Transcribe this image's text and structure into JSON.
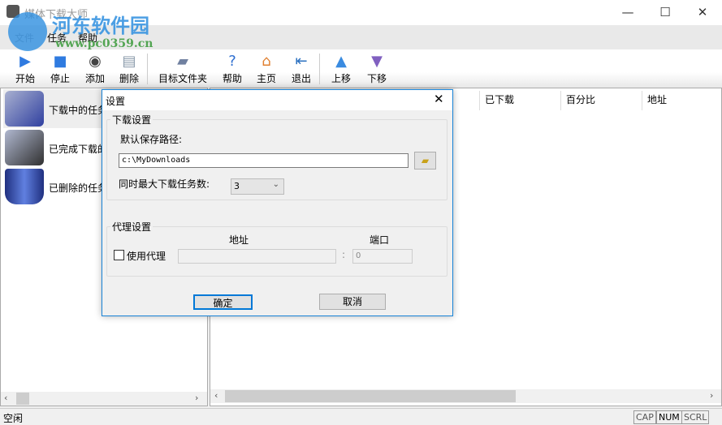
{
  "window": {
    "title": "媒体下载大师",
    "minimize": "—",
    "maximize": "☐",
    "close": "✕"
  },
  "menu": [
    "文件",
    "任务",
    "帮助"
  ],
  "toolbar": [
    {
      "label": "开始",
      "icon": "play-icon",
      "color": "#2f7be0"
    },
    {
      "label": "停止",
      "icon": "stop-icon",
      "color": "#2f7be0"
    },
    {
      "label": "添加",
      "icon": "add-icon",
      "color": "#444"
    },
    {
      "label": "删除",
      "icon": "delete-icon",
      "color": "#8899aa"
    },
    {
      "label": "目标文件夹",
      "icon": "folder-icon",
      "color": "#7080a0"
    },
    {
      "label": "帮助",
      "icon": "help-icon",
      "color": "#2f6fd0"
    },
    {
      "label": "主页",
      "icon": "home-icon",
      "color": "#e08030"
    },
    {
      "label": "退出",
      "icon": "exit-icon",
      "color": "#2a70c0"
    },
    {
      "label": "上移",
      "icon": "arrow-up-icon",
      "color": "#3a8be0"
    },
    {
      "label": "下移",
      "icon": "arrow-down-icon",
      "color": "#8060c0"
    }
  ],
  "left_tree": [
    {
      "label": "下载中的任务",
      "icon": "downloading-folder-icon"
    },
    {
      "label": "已完成下载的",
      "icon": "completed-video-folder-icon"
    },
    {
      "label": "已删除的任务",
      "icon": "recycle-bin-icon"
    }
  ],
  "columns": [
    "已下载",
    "百分比",
    "地址"
  ],
  "status": {
    "text": "空闲",
    "indicators": [
      "CAP",
      "NUM",
      "SCRL"
    ]
  },
  "dialog": {
    "title": "设置",
    "close": "✕",
    "download_group": "下载设置",
    "path_label": "默认保存路径:",
    "path_value": "c:\\MyDownloads",
    "max_tasks_label": "同时最大下载任务数:",
    "max_tasks_value": "3",
    "proxy_group": "代理设置",
    "address_label": "地址",
    "port_label": "端口",
    "use_proxy_label": "使用代理",
    "use_proxy_checked": false,
    "address_value": "",
    "port_sep": ":",
    "port_value": "0",
    "ok": "确定",
    "cancel": "取消"
  },
  "watermark": {
    "name": "河东软件园",
    "url": "www.pc0359.cn"
  }
}
